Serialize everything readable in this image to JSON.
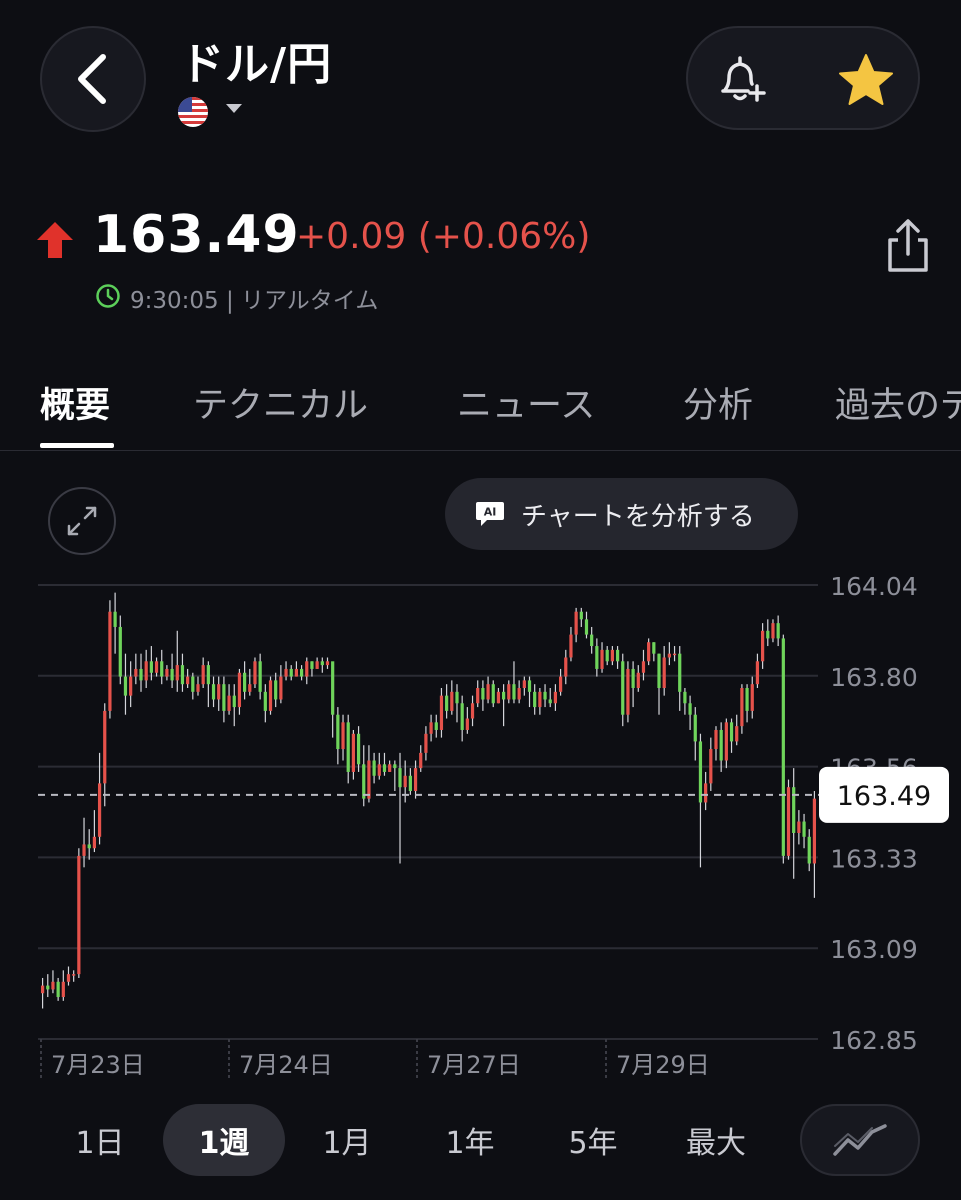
{
  "header": {
    "title": "ドル/円",
    "flag_icon": "us-flag-icon"
  },
  "quote": {
    "price": "163.49",
    "change": "+0.09 (+0.06%)",
    "time": "9:30:05 | リアルタイム",
    "direction": "up",
    "up_color": "#e5524b",
    "accent_green": "#5ccf5a"
  },
  "tabs": [
    {
      "label": "概要",
      "active": true
    },
    {
      "label": "テクニカル"
    },
    {
      "label": "ニュース"
    },
    {
      "label": "分析"
    },
    {
      "label": "過去のデ"
    }
  ],
  "chart_controls": {
    "ai_button_label": "チャートを分析する"
  },
  "ranges": [
    {
      "label": "1日"
    },
    {
      "label": "1週",
      "active": true
    },
    {
      "label": "1月"
    },
    {
      "label": "1年"
    },
    {
      "label": "5年"
    },
    {
      "label": "最大"
    }
  ],
  "chart_data": {
    "type": "candlestick",
    "y_ticks": [
      "164.04",
      "163.80",
      "163.56",
      "163.33",
      "163.09",
      "162.85"
    ],
    "ylim": [
      162.85,
      164.04
    ],
    "x_ticks": [
      "7月23日",
      "7月24日",
      "7月27日",
      "7月29日"
    ],
    "current_price_label": "163.49",
    "current_price": 163.49,
    "grid": true,
    "up_color": "#e5524b",
    "down_color": "#6fd45b",
    "candles": [
      [
        162.97,
        162.99,
        162.93,
        163.01
      ],
      [
        162.99,
        162.98,
        162.96,
        163.02
      ],
      [
        162.98,
        163.0,
        162.97,
        163.03
      ],
      [
        163.0,
        162.96,
        162.95,
        163.01
      ],
      [
        162.96,
        163.0,
        162.95,
        163.03
      ],
      [
        163.0,
        163.02,
        162.99,
        163.04
      ],
      [
        163.02,
        163.02,
        163.0,
        163.03
      ],
      [
        163.02,
        163.33,
        163.01,
        163.35
      ],
      [
        163.33,
        163.36,
        163.3,
        163.43
      ],
      [
        163.36,
        163.35,
        163.32,
        163.4
      ],
      [
        163.35,
        163.38,
        163.34,
        163.45
      ],
      [
        163.38,
        163.52,
        163.36,
        163.6
      ],
      [
        163.52,
        163.71,
        163.46,
        163.73
      ],
      [
        163.71,
        163.97,
        163.69,
        164.0
      ],
      [
        163.97,
        163.93,
        163.86,
        164.02
      ],
      [
        163.93,
        163.8,
        163.78,
        163.96
      ],
      [
        163.8,
        163.75,
        163.7,
        163.86
      ],
      [
        163.75,
        163.8,
        163.72,
        163.84
      ],
      [
        163.8,
        163.82,
        163.78,
        163.86
      ],
      [
        163.82,
        163.79,
        163.76,
        163.86
      ],
      [
        163.79,
        163.84,
        163.77,
        163.87
      ],
      [
        163.84,
        163.81,
        163.79,
        163.88
      ],
      [
        163.81,
        163.84,
        163.8,
        163.85
      ],
      [
        163.84,
        163.8,
        163.78,
        163.87
      ],
      [
        163.8,
        163.82,
        163.79,
        163.83
      ],
      [
        163.82,
        163.79,
        163.77,
        163.86
      ],
      [
        163.79,
        163.83,
        163.76,
        163.92
      ],
      [
        163.83,
        163.78,
        163.76,
        163.86
      ],
      [
        163.78,
        163.8,
        163.77,
        163.82
      ],
      [
        163.8,
        163.76,
        163.74,
        163.81
      ],
      [
        163.76,
        163.78,
        163.75,
        163.8
      ],
      [
        163.78,
        163.83,
        163.77,
        163.85
      ],
      [
        163.83,
        163.78,
        163.72,
        163.84
      ],
      [
        163.78,
        163.74,
        163.72,
        163.8
      ],
      [
        163.74,
        163.78,
        163.71,
        163.8
      ],
      [
        163.78,
        163.71,
        163.68,
        163.8
      ],
      [
        163.71,
        163.75,
        163.7,
        163.78
      ],
      [
        163.75,
        163.72,
        163.67,
        163.78
      ],
      [
        163.72,
        163.81,
        163.7,
        163.82
      ],
      [
        163.81,
        163.76,
        163.74,
        163.84
      ],
      [
        163.76,
        163.78,
        163.75,
        163.82
      ],
      [
        163.78,
        163.84,
        163.77,
        163.85
      ],
      [
        163.84,
        163.76,
        163.74,
        163.86
      ],
      [
        163.76,
        163.71,
        163.68,
        163.78
      ],
      [
        163.71,
        163.79,
        163.7,
        163.8
      ],
      [
        163.79,
        163.74,
        163.72,
        163.81
      ],
      [
        163.74,
        163.8,
        163.73,
        163.83
      ],
      [
        163.8,
        163.82,
        163.79,
        163.84
      ],
      [
        163.82,
        163.8,
        163.79,
        163.83
      ],
      [
        163.8,
        163.82,
        163.8,
        163.84
      ],
      [
        163.82,
        163.8,
        163.79,
        163.83
      ],
      [
        163.8,
        163.84,
        163.78,
        163.85
      ],
      [
        163.84,
        163.82,
        163.8,
        163.84
      ],
      [
        163.82,
        163.84,
        163.82,
        163.85
      ],
      [
        163.84,
        163.83,
        163.81,
        163.85
      ],
      [
        163.83,
        163.84,
        163.82,
        163.85
      ],
      [
        163.84,
        163.7,
        163.64,
        163.74
      ],
      [
        163.7,
        163.61,
        163.57,
        163.72
      ],
      [
        163.61,
        163.68,
        163.58,
        163.7
      ],
      [
        163.68,
        163.55,
        163.52,
        163.7
      ],
      [
        163.55,
        163.65,
        163.53,
        163.66
      ],
      [
        163.65,
        163.57,
        163.55,
        163.67
      ],
      [
        163.57,
        163.48,
        163.46,
        163.62
      ],
      [
        163.48,
        163.58,
        163.47,
        163.62
      ],
      [
        163.58,
        163.54,
        163.52,
        163.6
      ],
      [
        163.54,
        163.57,
        163.53,
        163.6
      ],
      [
        163.57,
        163.55,
        163.54,
        163.6
      ],
      [
        163.55,
        163.57,
        163.55,
        163.58
      ],
      [
        163.57,
        163.56,
        163.5,
        163.58
      ],
      [
        163.56,
        163.51,
        163.31,
        163.6
      ],
      [
        163.51,
        163.54,
        163.47,
        163.58
      ],
      [
        163.54,
        163.5,
        163.49,
        163.56
      ],
      [
        163.5,
        163.56,
        163.48,
        163.58
      ],
      [
        163.56,
        163.6,
        163.55,
        163.62
      ],
      [
        163.6,
        163.65,
        163.58,
        163.67
      ],
      [
        163.65,
        163.68,
        163.63,
        163.7
      ],
      [
        163.68,
        163.66,
        163.64,
        163.7
      ],
      [
        163.66,
        163.75,
        163.64,
        163.77
      ],
      [
        163.75,
        163.71,
        163.69,
        163.78
      ],
      [
        163.71,
        163.76,
        163.7,
        163.79
      ],
      [
        163.76,
        163.73,
        163.68,
        163.78
      ],
      [
        163.73,
        163.66,
        163.63,
        163.75
      ],
      [
        163.66,
        163.69,
        163.65,
        163.72
      ],
      [
        163.69,
        163.73,
        163.67,
        163.75
      ],
      [
        163.73,
        163.77,
        163.72,
        163.79
      ],
      [
        163.77,
        163.74,
        163.71,
        163.79
      ],
      [
        163.74,
        163.78,
        163.73,
        163.8
      ],
      [
        163.78,
        163.73,
        163.72,
        163.79
      ],
      [
        163.73,
        163.76,
        163.73,
        163.77
      ],
      [
        163.76,
        163.74,
        163.67,
        163.78
      ],
      [
        163.74,
        163.78,
        163.73,
        163.79
      ],
      [
        163.78,
        163.74,
        163.73,
        163.84
      ],
      [
        163.74,
        163.77,
        163.73,
        163.79
      ],
      [
        163.77,
        163.79,
        163.75,
        163.8
      ],
      [
        163.79,
        163.76,
        163.72,
        163.8
      ],
      [
        163.76,
        163.72,
        163.7,
        163.78
      ],
      [
        163.72,
        163.76,
        163.7,
        163.77
      ],
      [
        163.76,
        163.74,
        163.72,
        163.78
      ],
      [
        163.74,
        163.73,
        163.72,
        163.77
      ],
      [
        163.73,
        163.76,
        163.71,
        163.78
      ],
      [
        163.76,
        163.8,
        163.75,
        163.82
      ],
      [
        163.8,
        163.85,
        163.78,
        163.87
      ],
      [
        163.85,
        163.91,
        163.84,
        163.93
      ],
      [
        163.91,
        163.97,
        163.89,
        163.98
      ],
      [
        163.97,
        163.95,
        163.93,
        163.98
      ],
      [
        163.95,
        163.91,
        163.9,
        163.97
      ],
      [
        163.91,
        163.88,
        163.86,
        163.93
      ],
      [
        163.88,
        163.82,
        163.8,
        163.9
      ],
      [
        163.82,
        163.87,
        163.81,
        163.89
      ],
      [
        163.87,
        163.84,
        163.83,
        163.88
      ],
      [
        163.84,
        163.87,
        163.83,
        163.88
      ],
      [
        163.87,
        163.84,
        163.82,
        163.88
      ],
      [
        163.84,
        163.7,
        163.67,
        163.86
      ],
      [
        163.7,
        163.82,
        163.68,
        163.84
      ],
      [
        163.82,
        163.77,
        163.72,
        163.84
      ],
      [
        163.77,
        163.81,
        163.76,
        163.83
      ],
      [
        163.81,
        163.84,
        163.79,
        163.87
      ],
      [
        163.84,
        163.89,
        163.83,
        163.9
      ],
      [
        163.89,
        163.86,
        163.84,
        163.89
      ],
      [
        163.86,
        163.77,
        163.7,
        163.86
      ],
      [
        163.77,
        163.85,
        163.75,
        163.88
      ],
      [
        163.85,
        163.86,
        163.83,
        163.89
      ],
      [
        163.86,
        163.86,
        163.84,
        163.88
      ],
      [
        163.86,
        163.76,
        163.71,
        163.88
      ],
      [
        163.76,
        163.73,
        163.7,
        163.77
      ],
      [
        163.73,
        163.7,
        163.66,
        163.75
      ],
      [
        163.7,
        163.63,
        163.58,
        163.72
      ],
      [
        163.63,
        163.47,
        163.3,
        163.65
      ],
      [
        163.47,
        163.52,
        163.45,
        163.55
      ],
      [
        163.52,
        163.61,
        163.5,
        163.64
      ],
      [
        163.61,
        163.66,
        163.58,
        163.67
      ],
      [
        163.66,
        163.58,
        163.55,
        163.68
      ],
      [
        163.58,
        163.68,
        163.56,
        163.69
      ],
      [
        163.68,
        163.63,
        163.6,
        163.69
      ],
      [
        163.63,
        163.67,
        163.62,
        163.7
      ],
      [
        163.67,
        163.77,
        163.65,
        163.78
      ],
      [
        163.77,
        163.71,
        163.68,
        163.78
      ],
      [
        163.71,
        163.78,
        163.69,
        163.8
      ],
      [
        163.78,
        163.84,
        163.77,
        163.86
      ],
      [
        163.84,
        163.92,
        163.82,
        163.94
      ],
      [
        163.92,
        163.9,
        163.88,
        163.95
      ],
      [
        163.9,
        163.94,
        163.89,
        163.95
      ],
      [
        163.94,
        163.9,
        163.88,
        163.96
      ],
      [
        163.9,
        163.33,
        163.31,
        163.91
      ],
      [
        163.33,
        163.51,
        163.32,
        163.53
      ],
      [
        163.51,
        163.39,
        163.27,
        163.56
      ],
      [
        163.39,
        163.42,
        163.36,
        163.45
      ],
      [
        163.42,
        163.38,
        163.35,
        163.44
      ],
      [
        163.38,
        163.31,
        163.29,
        163.4
      ],
      [
        163.31,
        163.48,
        163.22,
        163.5
      ]
    ]
  }
}
